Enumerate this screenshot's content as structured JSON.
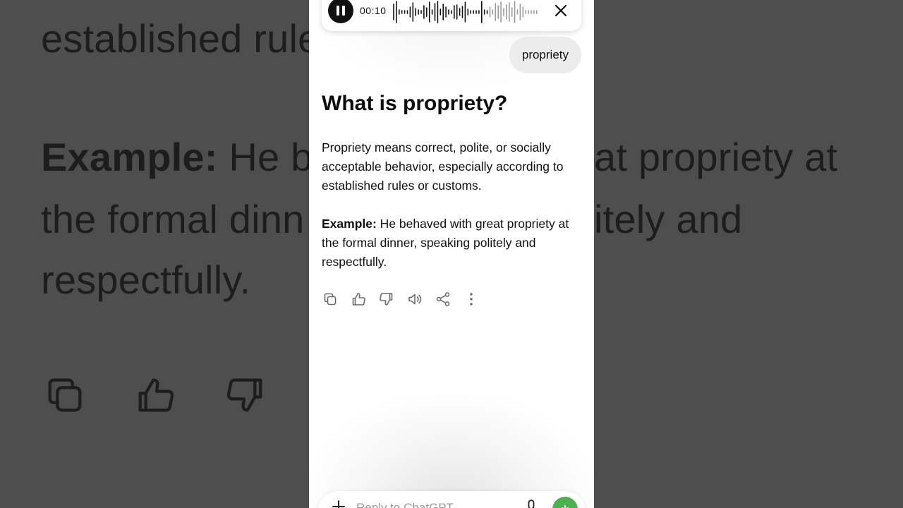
{
  "background": {
    "line1": "established rule",
    "example_label": "Example:",
    "example_line1_rest": " He be",
    "example_line1_right": "at propriety at",
    "example_line2_left": "the formal dinn",
    "example_line2_right": "itely and",
    "example_line3": "respectfully."
  },
  "voice_bar": {
    "timer": "00:10",
    "pause_icon": "pause-icon",
    "close_icon": "close-icon"
  },
  "user_message": "propriety",
  "answer": {
    "title": "What is propriety?",
    "paragraph1": "Propriety means correct, polite, or socially acceptable behavior, especially according to established rules or customs.",
    "example_label": "Example:",
    "example_text": " He behaved with great propriety at the formal dinner, speaking politely and respectfully."
  },
  "actions": [
    {
      "name": "copy-icon"
    },
    {
      "name": "thumbs-up-icon"
    },
    {
      "name": "thumbs-down-icon"
    },
    {
      "name": "read-aloud-icon"
    },
    {
      "name": "share-icon"
    },
    {
      "name": "more-options-icon"
    }
  ],
  "composer": {
    "placeholder": "Reply to ChatGPT",
    "plus_icon": "plus-icon",
    "mic_icon": "microphone-icon",
    "voice_icon": "voice-mode-icon"
  },
  "colors": {
    "accent_green": "#4caf50",
    "background_dim": "#4e4e4e"
  }
}
